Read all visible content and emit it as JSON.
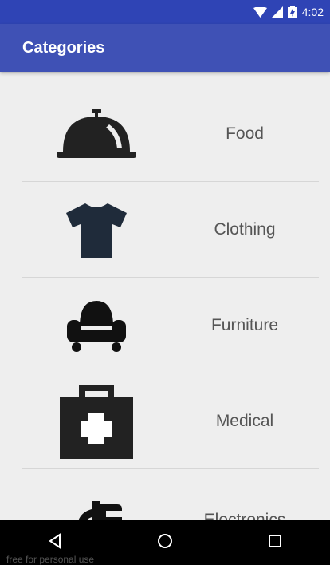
{
  "status_bar": {
    "time": "4:02",
    "icons": [
      "wifi-icon",
      "signal-icon",
      "battery-icon"
    ]
  },
  "app_bar": {
    "title": "Categories"
  },
  "categories": [
    {
      "label": "Food",
      "icon": "food-cloche-icon"
    },
    {
      "label": "Clothing",
      "icon": "tshirt-icon"
    },
    {
      "label": "Furniture",
      "icon": "armchair-icon"
    },
    {
      "label": "Medical",
      "icon": "medical-kit-icon"
    },
    {
      "label": "Electronics",
      "icon": "plug-icon"
    }
  ],
  "nav_bar": {
    "buttons": [
      "back-icon",
      "home-icon",
      "recents-icon"
    ]
  },
  "overlay_text": "free for personal use",
  "colors": {
    "primary": "#3f51b5",
    "status_bar": "#2f44b5",
    "background": "#eeeeee",
    "icon": "#222222"
  }
}
